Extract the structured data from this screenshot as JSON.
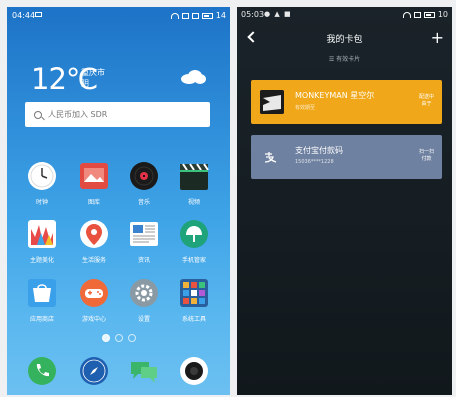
{
  "left_phone": {
    "status": {
      "time": "04:44",
      "battery": "14"
    },
    "weather": {
      "temperature": "12℃",
      "city": "重庆市",
      "condition": "阴"
    },
    "search": {
      "placeholder": "人民币加入 SDR"
    },
    "apps": [
      {
        "label": "时钟",
        "icon": "clock-icon"
      },
      {
        "label": "图库",
        "icon": "gallery-icon"
      },
      {
        "label": "音乐",
        "icon": "music-icon"
      },
      {
        "label": "视频",
        "icon": "video-icon"
      },
      {
        "label": "主题美化",
        "icon": "theme-icon"
      },
      {
        "label": "生活服务",
        "icon": "life-service-icon"
      },
      {
        "label": "资讯",
        "icon": "news-icon"
      },
      {
        "label": "手机管家",
        "icon": "phone-manager-icon"
      },
      {
        "label": "应用商店",
        "icon": "app-store-icon"
      },
      {
        "label": "游戏中心",
        "icon": "game-center-icon"
      },
      {
        "label": "设置",
        "icon": "settings-icon"
      },
      {
        "label": "系统工具",
        "icon": "system-tools-icon"
      }
    ],
    "dock": [
      "phone-icon",
      "browser-icon",
      "messages-icon",
      "camera-icon"
    ],
    "colors": {
      "wallpaper_top": "#1d73c7",
      "wallpaper_bottom": "#6cc0f1"
    }
  },
  "right_phone": {
    "status": {
      "time": "05:03",
      "battery": "10"
    },
    "header": {
      "title": "我的卡包",
      "add": "+"
    },
    "subtitle": "☰ 有效卡片",
    "cards": [
      {
        "title": "MONKEYMAN 星空尔",
        "subtitle": "有效期至",
        "action_line1": "配送中",
        "action_line2": "由于",
        "color": "#f0a81a"
      },
      {
        "title": "支付宝付款码",
        "subtitle": "15036****1228",
        "action_line1": "扫一扫",
        "action_line2": "付款",
        "color": "#6f81a0"
      }
    ]
  }
}
